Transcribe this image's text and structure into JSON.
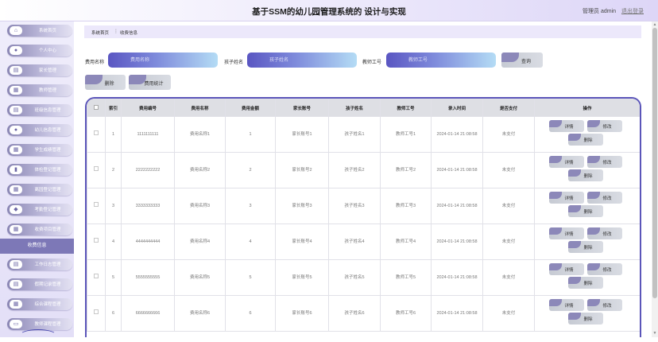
{
  "header": {
    "title": "基于SSM的幼儿园管理系统的 设计与实现",
    "user": "管理员 admin",
    "logout": "退出登录"
  },
  "sidebar": {
    "items": [
      {
        "label": "系统首页",
        "icon": "home-icon",
        "glyph": "⌂"
      },
      {
        "label": "个人中心",
        "icon": "user-icon",
        "glyph": "●"
      },
      {
        "label": "家长管理",
        "icon": "document-icon",
        "glyph": "▤"
      },
      {
        "label": "教师管理",
        "icon": "grid-icon",
        "glyph": "▦"
      },
      {
        "label": "班级信息管理",
        "icon": "document-icon",
        "glyph": "▤"
      },
      {
        "label": "幼儿信息管理",
        "icon": "user-icon",
        "glyph": "●"
      },
      {
        "label": "学生成绩管理",
        "icon": "grid-icon",
        "glyph": "▦"
      },
      {
        "label": "体检登记管理",
        "icon": "chart-icon",
        "glyph": "▮"
      },
      {
        "label": "离园登记管理",
        "icon": "grid-icon",
        "glyph": "▦"
      },
      {
        "label": "考勤登记管理",
        "icon": "pin-icon",
        "glyph": "◆"
      },
      {
        "label": "收费项目管理",
        "icon": "grid-icon",
        "glyph": "▦"
      }
    ],
    "active": "收费信息",
    "items_after": [
      {
        "label": "工作日志管理",
        "icon": "document-icon",
        "glyph": "▤"
      },
      {
        "label": "假期记录管理",
        "icon": "document-icon",
        "glyph": "▤"
      },
      {
        "label": "综合课程管理",
        "icon": "grid-icon",
        "glyph": "▦"
      },
      {
        "label": "教师课程管理",
        "icon": "printer-icon",
        "glyph": "▭"
      }
    ]
  },
  "breadcrumb": {
    "home": "系统首页",
    "separator": "⋮",
    "current": "收费信息"
  },
  "search": {
    "fields": [
      {
        "label": "费用名称",
        "placeholder": "费用名称"
      },
      {
        "label": "孩子姓名",
        "placeholder": "孩子姓名"
      },
      {
        "label": "教师工号",
        "placeholder": "教师工号"
      }
    ],
    "query_button": "查询",
    "delete_button": "删除",
    "stats_button": "费用统计"
  },
  "table": {
    "headers": [
      "索引",
      "费用编号",
      "费用名称",
      "费用金额",
      "家长账号",
      "孩子姓名",
      "教师工号",
      "录入时间",
      "是否支付",
      "操作"
    ],
    "rows": [
      {
        "index": "1",
        "code": "1111111111",
        "name": "费用名称1",
        "amount": "1",
        "parent": "家长账号1",
        "child": "孩子姓名1",
        "teacher": "教师工号1",
        "time": "2024-01-14 21:08:58",
        "paid": "未支付"
      },
      {
        "index": "2",
        "code": "2222222222",
        "name": "费用名称2",
        "amount": "2",
        "parent": "家长账号2",
        "child": "孩子姓名2",
        "teacher": "教师工号2",
        "time": "2024-01-14 21:08:58",
        "paid": "未支付"
      },
      {
        "index": "3",
        "code": "3333333333",
        "name": "费用名称3",
        "amount": "3",
        "parent": "家长账号3",
        "child": "孩子姓名3",
        "teacher": "教师工号3",
        "time": "2024-01-14 21:08:58",
        "paid": "未支付"
      },
      {
        "index": "4",
        "code": "4444444444",
        "name": "费用名称4",
        "amount": "4",
        "parent": "家长账号4",
        "child": "孩子姓名4",
        "teacher": "教师工号4",
        "time": "2024-01-14 21:08:58",
        "paid": "未支付"
      },
      {
        "index": "5",
        "code": "5555555555",
        "name": "费用名称5",
        "amount": "5",
        "parent": "家长账号5",
        "child": "孩子姓名5",
        "teacher": "教师工号5",
        "time": "2024-01-14 21:08:58",
        "paid": "未支付"
      },
      {
        "index": "6",
        "code": "6666666666",
        "name": "费用名称6",
        "amount": "6",
        "parent": "家长账号6",
        "child": "孩子姓名6",
        "teacher": "教师工号6",
        "time": "2024-01-14 21:08:58",
        "paid": "未支付"
      }
    ],
    "actions": {
      "detail": "详情",
      "edit": "修改",
      "delete": "删除"
    }
  },
  "colors": {
    "accent": "#5b55b9",
    "sidebar_active": "#7d78b7",
    "input_gradient_start": "#5a56c2",
    "input_gradient_end": "#b4dcf5"
  }
}
